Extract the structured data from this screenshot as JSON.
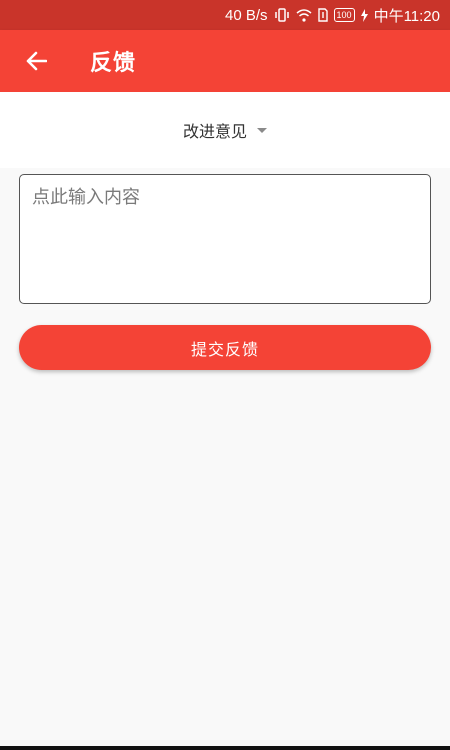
{
  "status_bar": {
    "speed": "40 B/s",
    "icons": [
      "vibrate-icon",
      "wifi-icon",
      "sim-icon",
      "battery-icon",
      "charging-icon"
    ],
    "battery": "100",
    "time": "中午11:20"
  },
  "app_bar": {
    "title": "反馈",
    "back_icon": "arrow-left-icon",
    "color": "#f44336"
  },
  "feedback_type": {
    "selected": "改进意见"
  },
  "content": {
    "placeholder": "点此输入内容",
    "value": ""
  },
  "submit": {
    "label": "提交反馈"
  }
}
